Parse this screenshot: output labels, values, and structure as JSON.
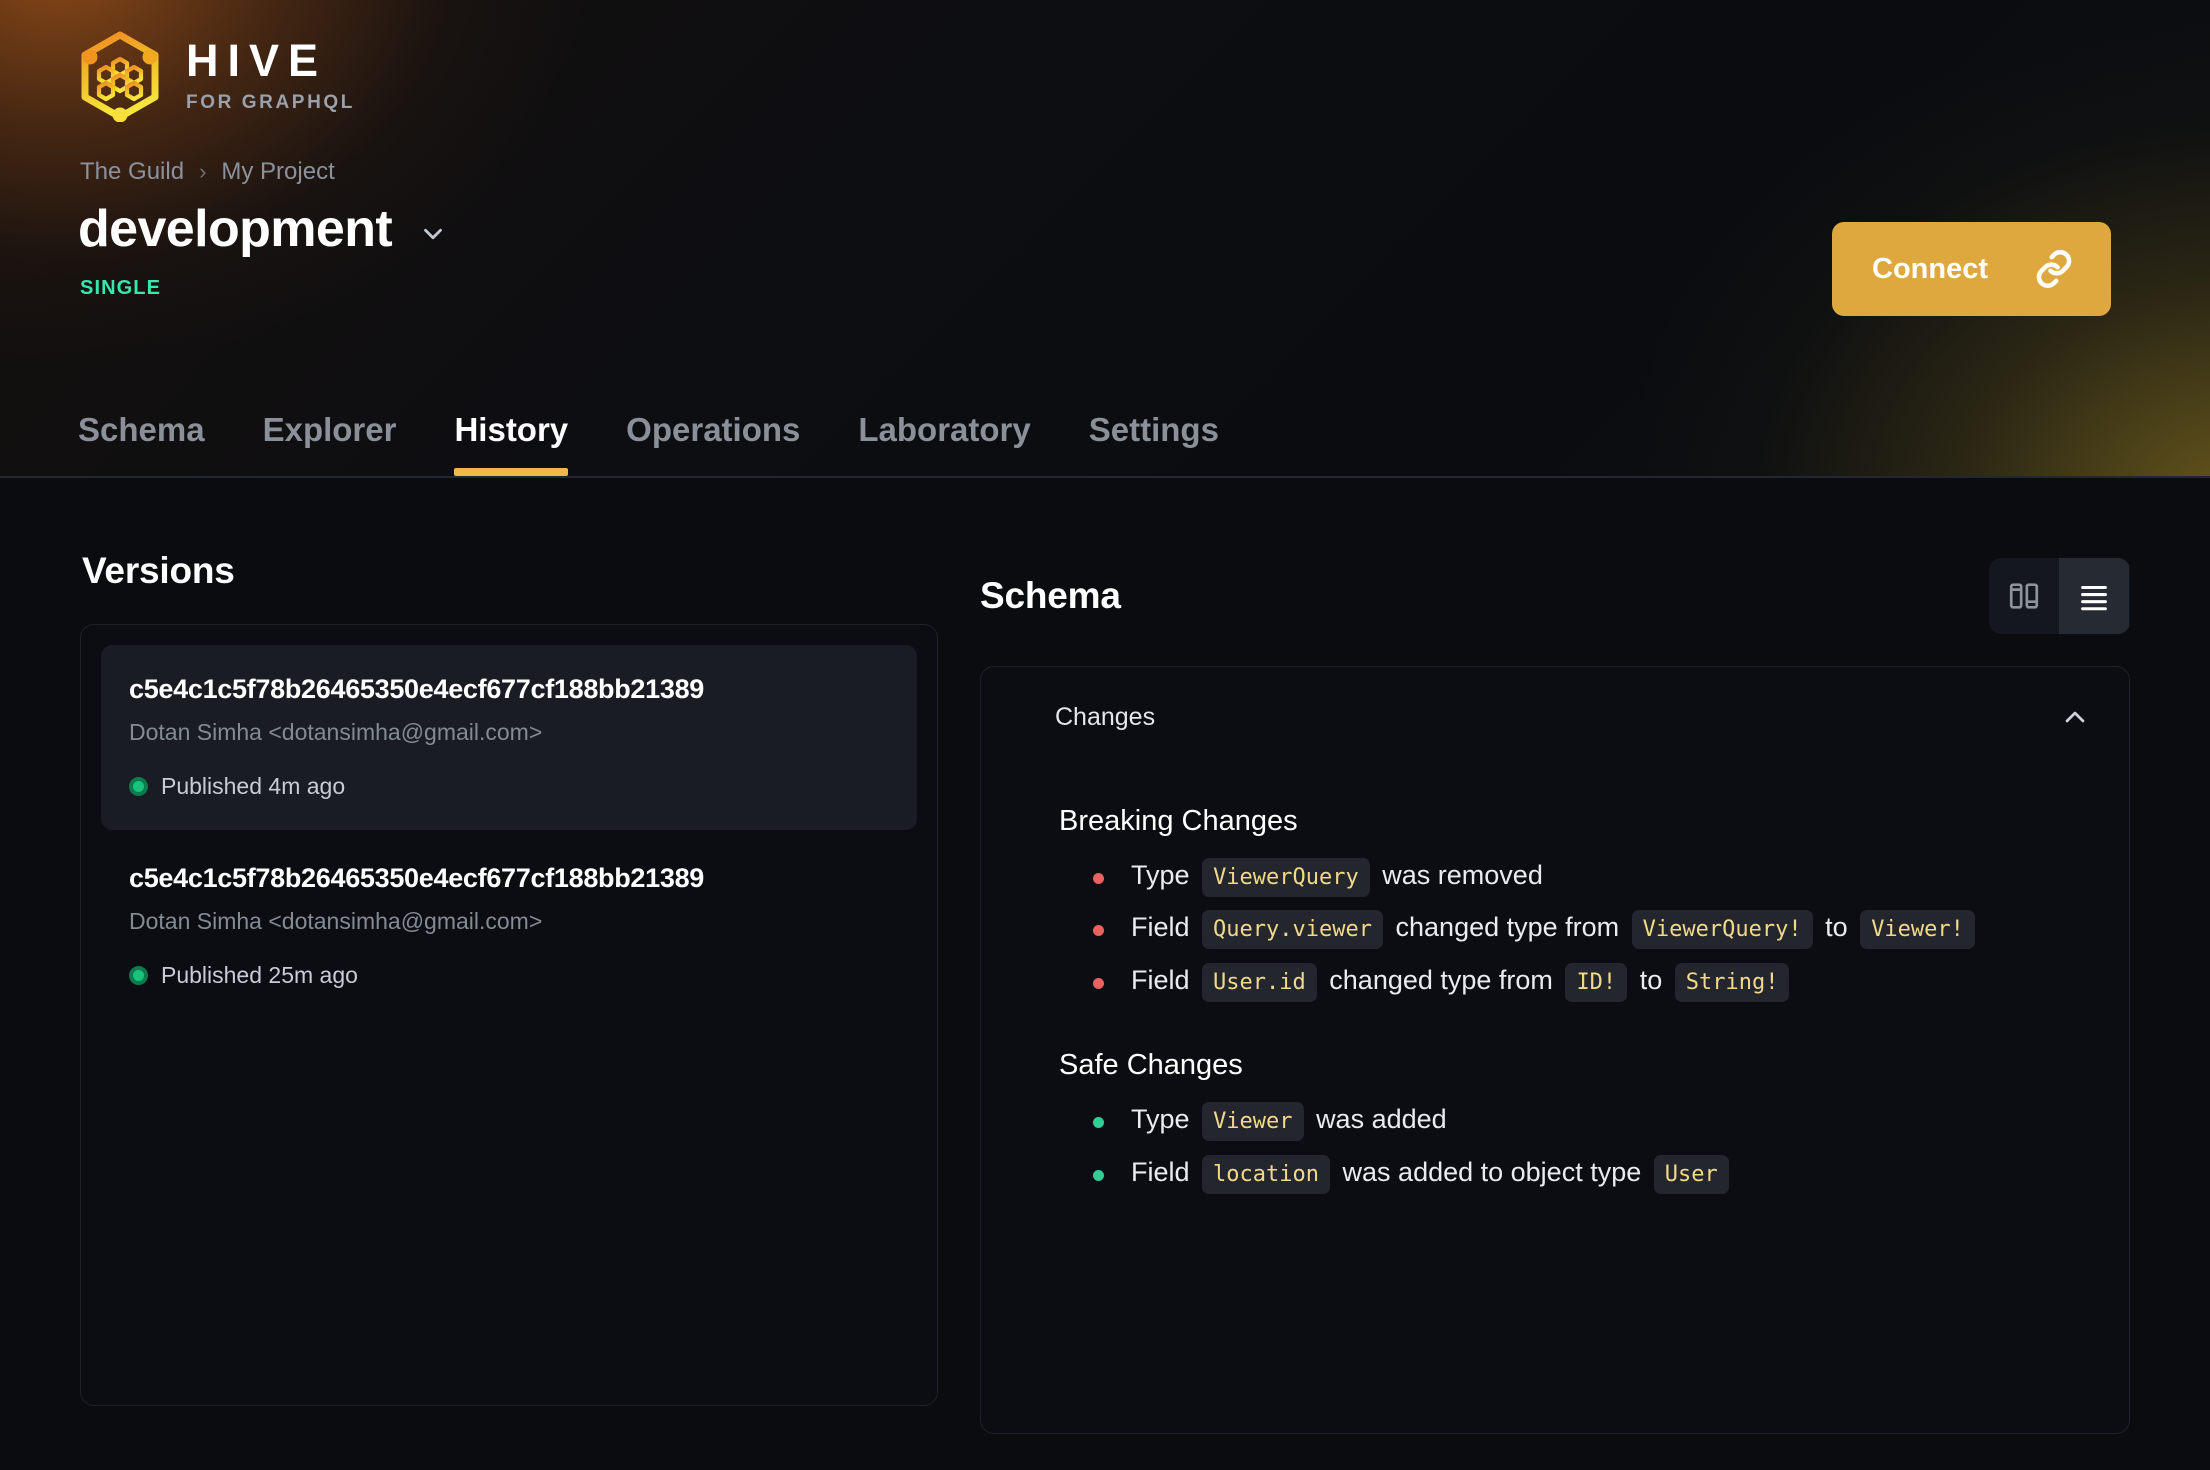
{
  "brand": {
    "name": "HIVE",
    "tagline": "FOR GRAPHQL",
    "logo_icon": "hive-hexagon-logo",
    "accent": "#f0b84a"
  },
  "header": {
    "breadcrumb": [
      {
        "label": "The Guild"
      },
      {
        "label": "My Project"
      }
    ],
    "breadcrumb_separator": "›",
    "title": "development",
    "title_chevron_icon": "chevron-down-icon",
    "badge": "SINGLE",
    "badge_color": "#3ae6b0",
    "connect": {
      "label": "Connect",
      "icon": "link-icon",
      "bg": "#dfa83e"
    },
    "tabs": [
      {
        "label": "Schema",
        "active": false
      },
      {
        "label": "Explorer",
        "active": false
      },
      {
        "label": "History",
        "active": true
      },
      {
        "label": "Operations",
        "active": false
      },
      {
        "label": "Laboratory",
        "active": false
      },
      {
        "label": "Settings",
        "active": false
      }
    ]
  },
  "versions": {
    "title": "Versions",
    "items": [
      {
        "hash": "c5e4c1c5f78b26465350e4ecf677cf188bb21389",
        "author": "Dotan Simha <dotansimha@gmail.com>",
        "status": "Published 4m ago",
        "selected": true
      },
      {
        "hash": "c5e4c1c5f78b26465350e4ecf677cf188bb21389",
        "author": "Dotan Simha <dotansimha@gmail.com>",
        "status": "Published 25m ago",
        "selected": false
      }
    ]
  },
  "schema": {
    "title": "Schema",
    "view_toggle": [
      {
        "icon": "panels-layout-icon",
        "active": false
      },
      {
        "icon": "list-view-icon",
        "active": true
      }
    ],
    "changes": {
      "label": "Changes",
      "collapse_icon": "chevron-up-icon",
      "breaking": {
        "title": "Breaking Changes",
        "bullet_color": "#e8625e",
        "items": [
          {
            "parts": [
              {
                "t": "text",
                "v": "Type"
              },
              {
                "t": "code",
                "v": "ViewerQuery"
              },
              {
                "t": "text",
                "v": "was removed"
              }
            ]
          },
          {
            "parts": [
              {
                "t": "text",
                "v": "Field"
              },
              {
                "t": "code",
                "v": "Query.viewer"
              },
              {
                "t": "text",
                "v": "changed type from"
              },
              {
                "t": "code",
                "v": "ViewerQuery!"
              },
              {
                "t": "text",
                "v": "to"
              },
              {
                "t": "code",
                "v": "Viewer!"
              }
            ]
          },
          {
            "parts": [
              {
                "t": "text",
                "v": "Field"
              },
              {
                "t": "code",
                "v": "User.id"
              },
              {
                "t": "text",
                "v": "changed type from"
              },
              {
                "t": "code",
                "v": "ID!"
              },
              {
                "t": "text",
                "v": "to"
              },
              {
                "t": "code",
                "v": "String!"
              }
            ]
          }
        ]
      },
      "safe": {
        "title": "Safe Changes",
        "bullet_color": "#2fcf96",
        "items": [
          {
            "parts": [
              {
                "t": "text",
                "v": "Type"
              },
              {
                "t": "code",
                "v": "Viewer"
              },
              {
                "t": "text",
                "v": "was added"
              }
            ]
          },
          {
            "parts": [
              {
                "t": "text",
                "v": "Field"
              },
              {
                "t": "code",
                "v": "location"
              },
              {
                "t": "text",
                "v": "was added to object type"
              },
              {
                "t": "code",
                "v": "User"
              }
            ]
          }
        ]
      }
    }
  }
}
